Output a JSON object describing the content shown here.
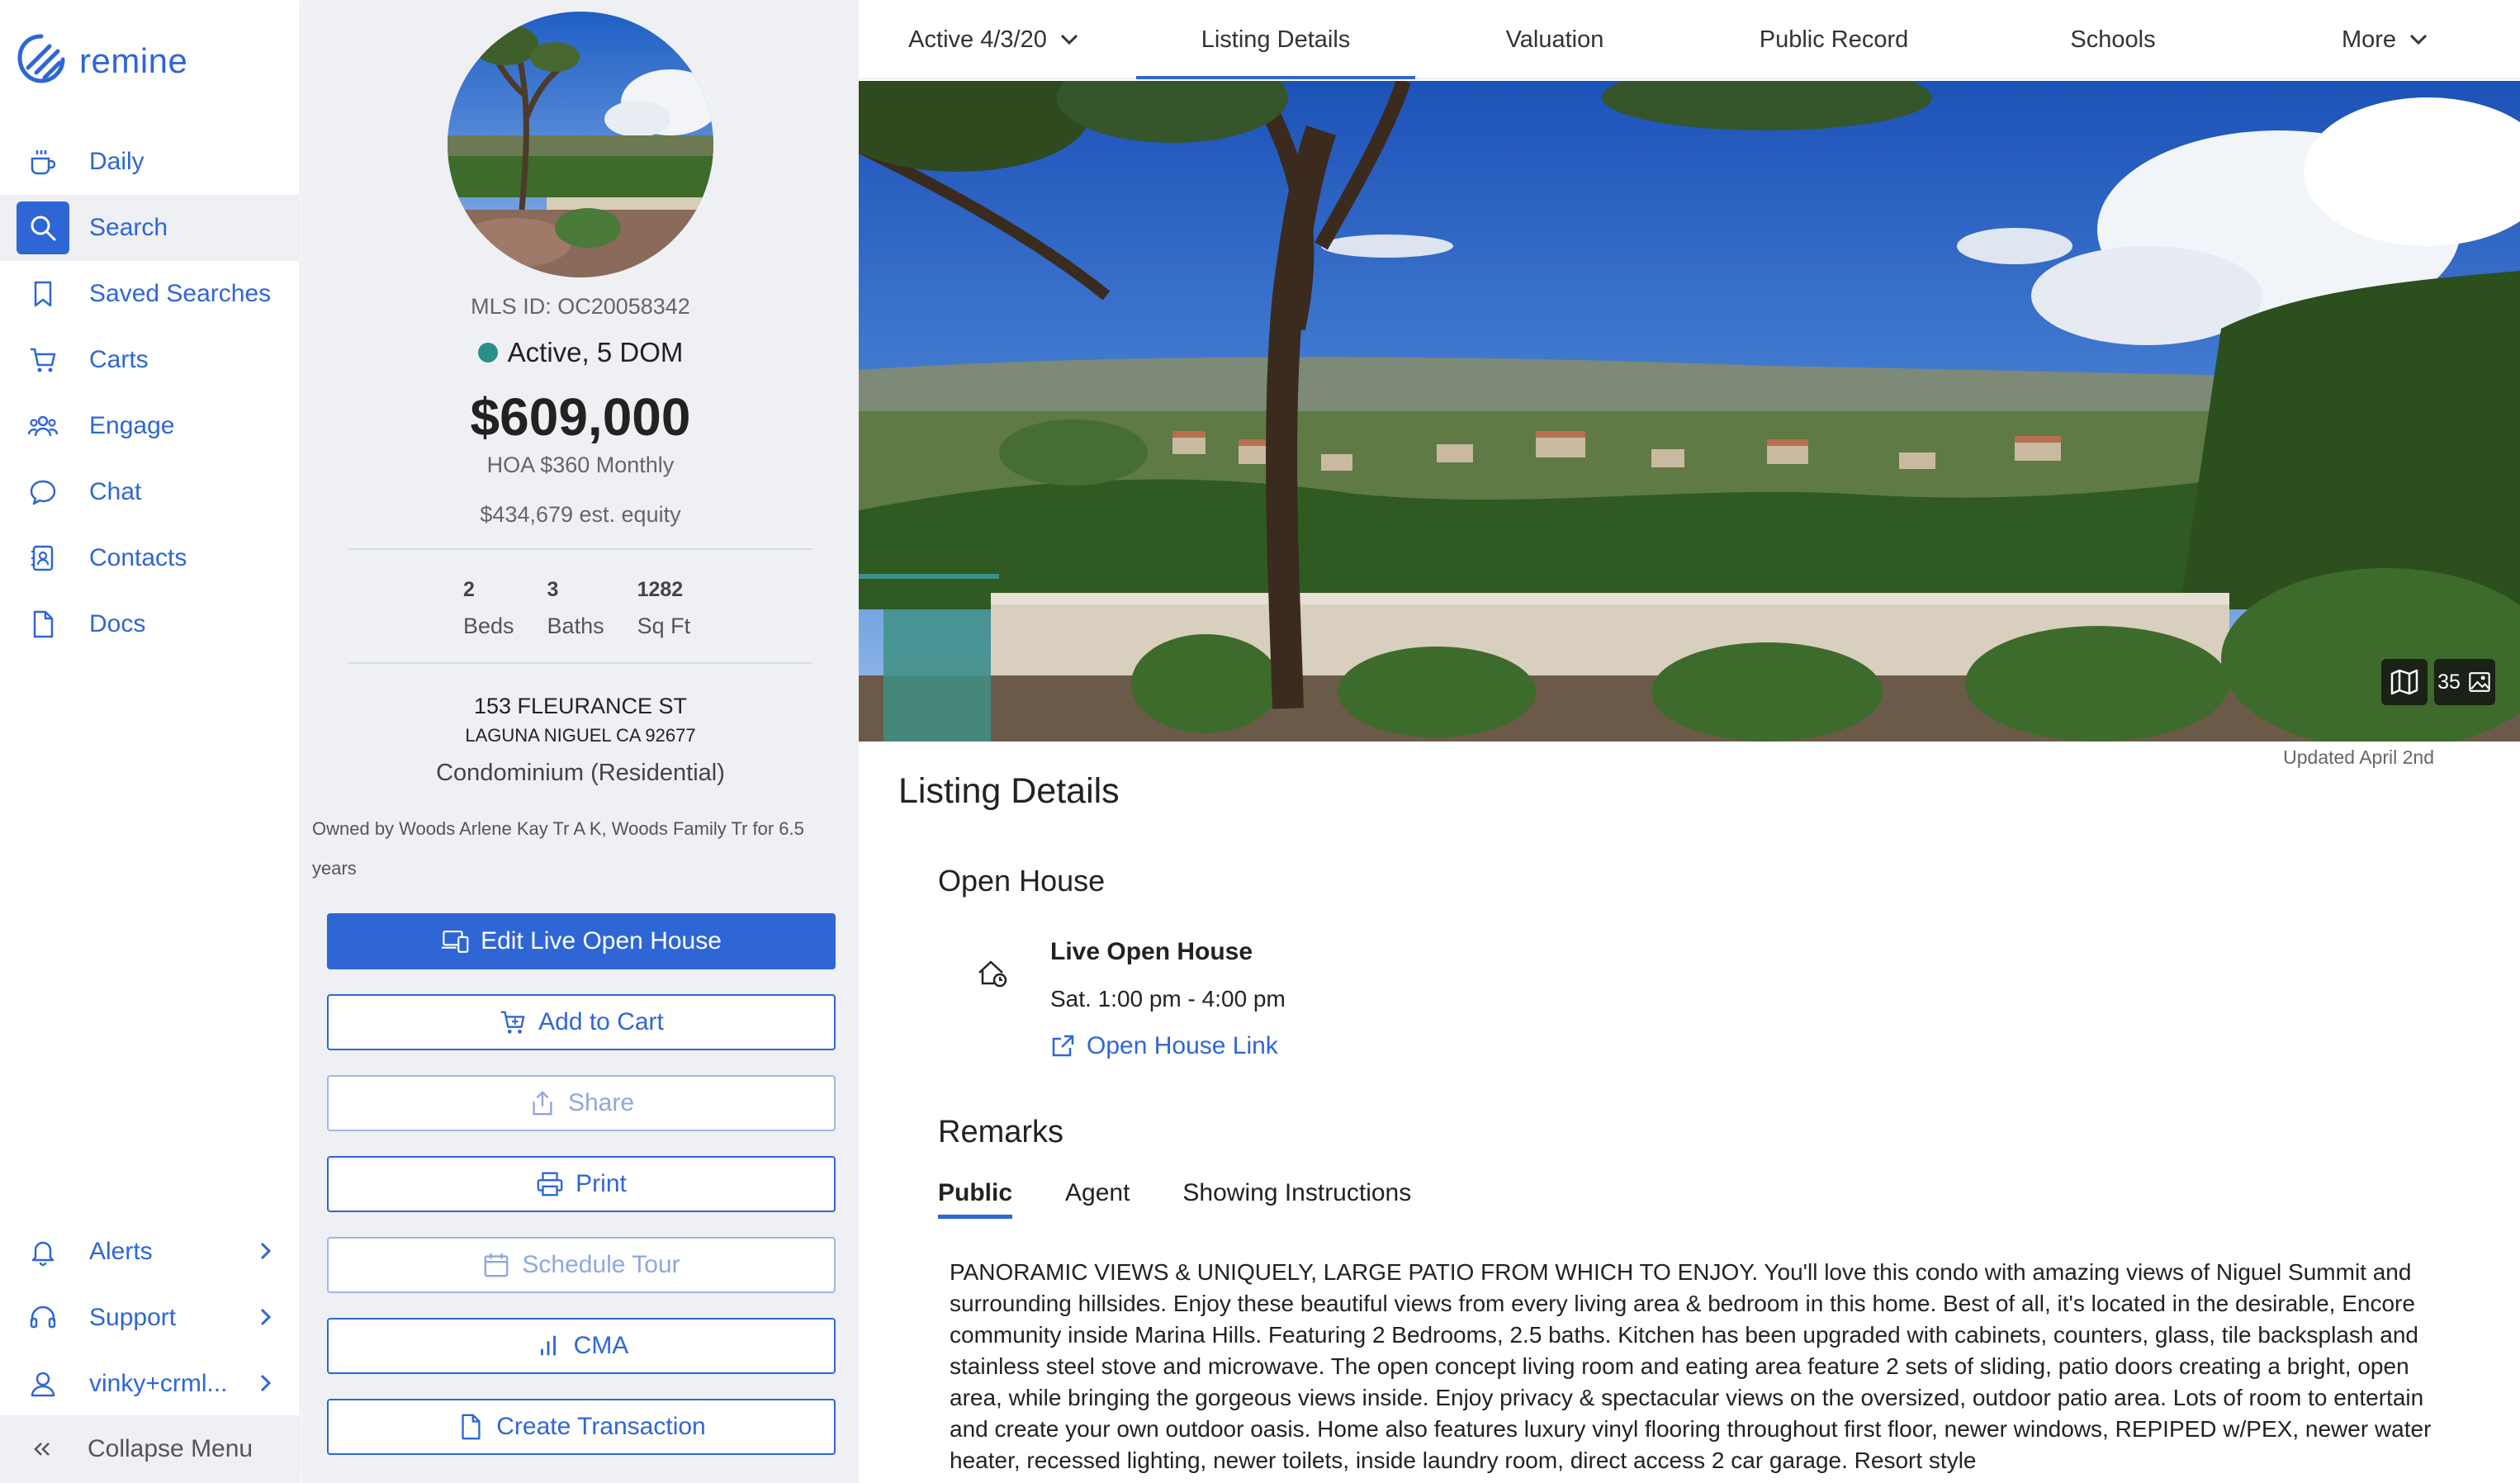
{
  "brand": {
    "name": "remine"
  },
  "sidebar": {
    "items": [
      {
        "label": "Daily",
        "icon": "coffee-icon"
      },
      {
        "label": "Search",
        "icon": "search-icon",
        "active": true
      },
      {
        "label": "Saved Searches",
        "icon": "bookmark-icon"
      },
      {
        "label": "Carts",
        "icon": "cart-icon"
      },
      {
        "label": "Engage",
        "icon": "users-icon"
      },
      {
        "label": "Chat",
        "icon": "chat-icon"
      },
      {
        "label": "Contacts",
        "icon": "contacts-icon"
      },
      {
        "label": "Docs",
        "icon": "doc-icon"
      }
    ],
    "bottom": [
      {
        "label": "Alerts",
        "icon": "bell-icon"
      },
      {
        "label": "Support",
        "icon": "headset-icon"
      },
      {
        "label": "vinky+crml...",
        "icon": "user-icon"
      }
    ],
    "collapse_label": "Collapse Menu"
  },
  "summary": {
    "mls_id": "MLS ID: OC20058342",
    "status": "Active, 5 DOM",
    "status_color": "#2a8f8a",
    "price": "$609,000",
    "hoa": "HOA $360 Monthly",
    "equity": "$434,679 est. equity",
    "stats": [
      {
        "value": "2",
        "label": "Beds"
      },
      {
        "value": "3",
        "label": "Baths"
      },
      {
        "value": "1282",
        "label": "Sq Ft"
      }
    ],
    "address_line1": "153 FLEURANCE ST",
    "address_line2": "LAGUNA NIGUEL CA 92677",
    "property_type": "Condominium (Residential)",
    "owner": "Owned by Woods Arlene Kay Tr A K, Woods Family Tr for 6.5 years",
    "buttons": {
      "edit_live_open_house": "Edit Live Open House",
      "add_to_cart": "Add to Cart",
      "share": "Share",
      "print": "Print",
      "schedule_tour": "Schedule Tour",
      "cma": "CMA",
      "create_transaction": "Create Transaction"
    }
  },
  "tabs": {
    "status_dropdown": "Active 4/3/20",
    "listing_details": "Listing Details",
    "valuation": "Valuation",
    "public_record": "Public Record",
    "schools": "Schools",
    "more": "More"
  },
  "hero": {
    "photo_count": "35",
    "updated": "Updated April 2nd"
  },
  "details": {
    "heading": "Listing Details",
    "open_house_heading": "Open House",
    "open_house_title": "Live Open House",
    "open_house_time": "Sat. 1:00 pm - 4:00 pm",
    "open_house_link": "Open House Link",
    "remarks_heading": "Remarks",
    "remarks_tabs": [
      "Public",
      "Agent",
      "Showing Instructions"
    ],
    "remarks_text": "PANORAMIC VIEWS & UNIQUELY, LARGE PATIO FROM WHICH TO ENJOY. You'll love this condo with amazing views of Niguel Summit and surrounding hillsides. Enjoy these beautiful views from every living area & bedroom in this home. Best of all, it's located in the desirable, Encore community inside Marina Hills. Featuring 2 Bedrooms, 2.5 baths. Kitchen has been upgraded with cabinets, counters, glass, tile backsplash and stainless steel stove and microwave. The open concept living room and eating area feature 2 sets of sliding, patio doors creating a bright, open area, while bringing the gorgeous views inside. Enjoy privacy & spectacular views on the oversized, outdoor patio area. Lots of room to entertain and create your own outdoor oasis. Home also features luxury vinyl flooring throughout first floor, newer windows, REPIPED w/PEX, newer water heater, recessed lighting, newer toilets, inside laundry room, direct access 2 car garage. Resort style"
  },
  "colors": {
    "accent": "#2f66d6",
    "panel_bg": "#eef0f4"
  }
}
